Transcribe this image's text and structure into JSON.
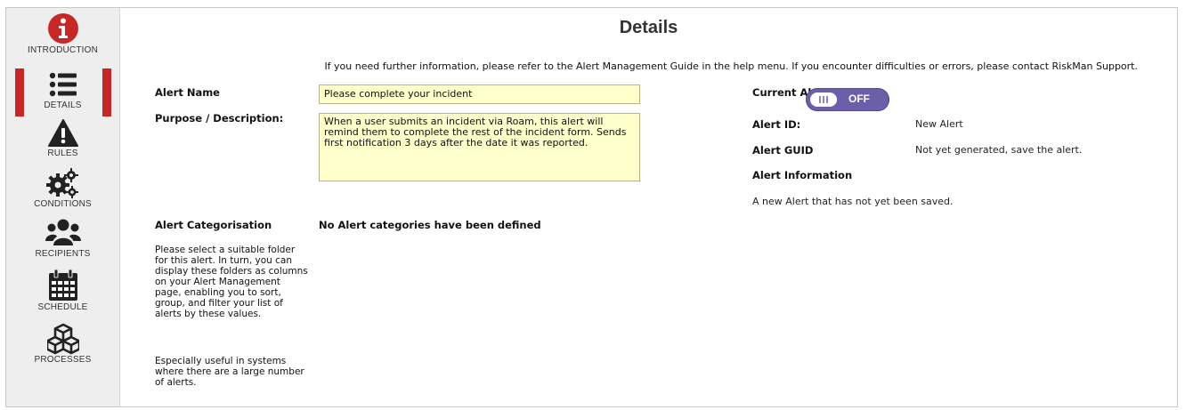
{
  "page_title": "Details",
  "info_text": "If you need further information, please refer to the Alert Management Guide in the help menu. If you encounter difficulties or errors, please contact RiskMan Support.",
  "sidebar": {
    "active": "DETAILS",
    "active_color": "#c62828",
    "items": [
      {
        "label": "INTRODUCTION",
        "icon": "info-circle-icon"
      },
      {
        "label": "DETAILS",
        "icon": "list-icon"
      },
      {
        "label": "RULES",
        "icon": "warning-triangle-icon"
      },
      {
        "label": "CONDITIONS",
        "icon": "gears-icon"
      },
      {
        "label": "RECIPIENTS",
        "icon": "users-icon"
      },
      {
        "label": "SCHEDULE",
        "icon": "calendar-icon"
      },
      {
        "label": "PROCESSES",
        "icon": "cubes-icon"
      }
    ]
  },
  "form": {
    "alert_name_label": "Alert Name",
    "alert_name_value": "Please complete your incident",
    "purpose_label": "Purpose / Description:",
    "purpose_value": "When a user submits an incident via Roam, this alert will remind them to complete the rest of the incident form. Sends first notification 3 days after the date it was reported.",
    "categorisation_label": "Alert Categorisation",
    "categorisation_value": "No Alert categories have been defined",
    "categorisation_help_1": "Please select a suitable folder for this alert. In turn, you can display these folders as columns on your Alert Management page, enabling you to sort, group, and filter your list of alerts by these values.",
    "categorisation_help_2": "Especially useful in systems where there are a large number of alerts.",
    "field_color": "#ffffcc"
  },
  "status": {
    "current_status_label": "Current Alert Status:",
    "toggle_text": "OFF",
    "toggle_color": "#6a5fa8",
    "alert_id_label": "Alert ID:",
    "alert_id_value": "New Alert",
    "alert_guid_label": "Alert GUID",
    "alert_guid_value": "Not yet generated, save the alert.",
    "alert_info_label": "Alert Information",
    "alert_info_value": "A new Alert that has not yet been saved."
  }
}
